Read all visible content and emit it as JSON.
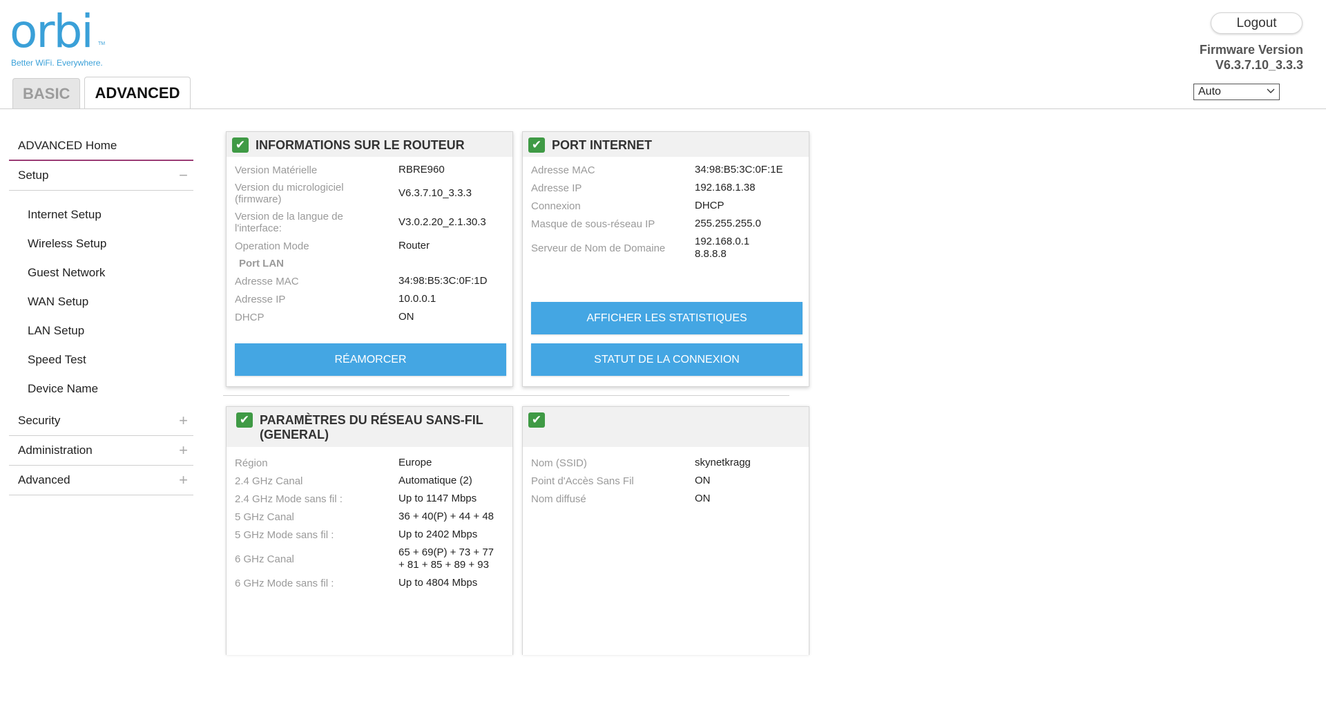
{
  "logo": {
    "word": "orbi",
    "tm": "TM",
    "tagline": "Better WiFi. Everywhere."
  },
  "tabs": {
    "basic": "BASIC",
    "advanced": "ADVANCED"
  },
  "header": {
    "logout": "Logout",
    "firmware_label": "Firmware Version",
    "firmware_value": "V6.3.7.10_3.3.3",
    "language": "Auto"
  },
  "sidebar": {
    "home": "ADVANCED Home",
    "setup": {
      "label": "Setup",
      "sign": "−"
    },
    "setup_items": [
      "Internet Setup",
      "Wireless Setup",
      "Guest Network",
      "WAN Setup",
      "LAN Setup",
      "Speed Test",
      "Device Name"
    ],
    "sections": [
      {
        "label": "Security",
        "sign": "+"
      },
      {
        "label": "Administration",
        "sign": "+"
      },
      {
        "label": "Advanced",
        "sign": "+"
      }
    ]
  },
  "router_panel": {
    "title": "INFORMATIONS SUR LE ROUTEUR",
    "rows": [
      {
        "label": "Version Matérielle",
        "value": "RBRE960"
      },
      {
        "label": "Version du micrologiciel (firmware)",
        "value": "V6.3.7.10_3.3.3"
      },
      {
        "label": "Version de la langue de l'interface:",
        "value": "V3.0.2.20_2.1.30.3"
      },
      {
        "label": "Operation Mode",
        "value": "Router"
      }
    ],
    "lan_label": "Port LAN",
    "lan_rows": [
      {
        "label": "Adresse MAC",
        "value": "34:98:B5:3C:0F:1D"
      },
      {
        "label": "Adresse IP",
        "value": "10.0.0.1"
      },
      {
        "label": "DHCP",
        "value": "ON"
      }
    ],
    "button": "RÉAMORCER"
  },
  "internet_panel": {
    "title": "PORT INTERNET",
    "rows": [
      {
        "label": "Adresse MAC",
        "value": "34:98:B5:3C:0F:1E"
      },
      {
        "label": "Adresse IP",
        "value": "192.168.1.38"
      },
      {
        "label": "Connexion",
        "value": "DHCP"
      },
      {
        "label": "Masque de sous-réseau IP",
        "value": "255.255.255.0"
      },
      {
        "label": "Serveur de Nom de Domaine",
        "value": "192.168.0.1",
        "value2": "8.8.8.8"
      }
    ],
    "button_stats": "AFFICHER LES STATISTIQUES",
    "button_status": "STATUT DE LA CONNEXION"
  },
  "wireless_panel": {
    "title_line1": "PARAMÈTRES DU RÉSEAU SANS-FIL",
    "title_line2": "(GENERAL)",
    "rows": [
      {
        "label": "Région",
        "value": "Europe"
      },
      {
        "label": "2.4 GHz Canal",
        "value": "Automatique (2)"
      },
      {
        "label": "2.4 GHz Mode sans fil :",
        "value": "Up to 1147 Mbps"
      },
      {
        "label": "5 GHz Canal",
        "value": "36 + 40(P) + 44 + 48"
      },
      {
        "label": "5 GHz Mode sans fil :",
        "value": "Up to 2402 Mbps"
      },
      {
        "label": "6 GHz Canal",
        "value": "65 + 69(P) + 73 + 77",
        "value2": "+ 81 + 85 + 89 + 93"
      },
      {
        "label": "6 GHz Mode sans fil :",
        "value": "Up to 4804 Mbps"
      }
    ]
  },
  "ssid_panel": {
    "rows": [
      {
        "label": "Nom (SSID)",
        "value": "skynetkragg"
      },
      {
        "label": "Point d'Accès Sans Fil",
        "value": "ON"
      },
      {
        "label": "Nom diffusé",
        "value": "ON"
      }
    ]
  },
  "icons": {
    "check": "check-icon",
    "chevron": "chevron-down-icon"
  },
  "colors": {
    "brand": "#3aa0d8",
    "button": "#44a6e3",
    "check": "#3f9a45",
    "accent_line": "#9b3c75"
  }
}
